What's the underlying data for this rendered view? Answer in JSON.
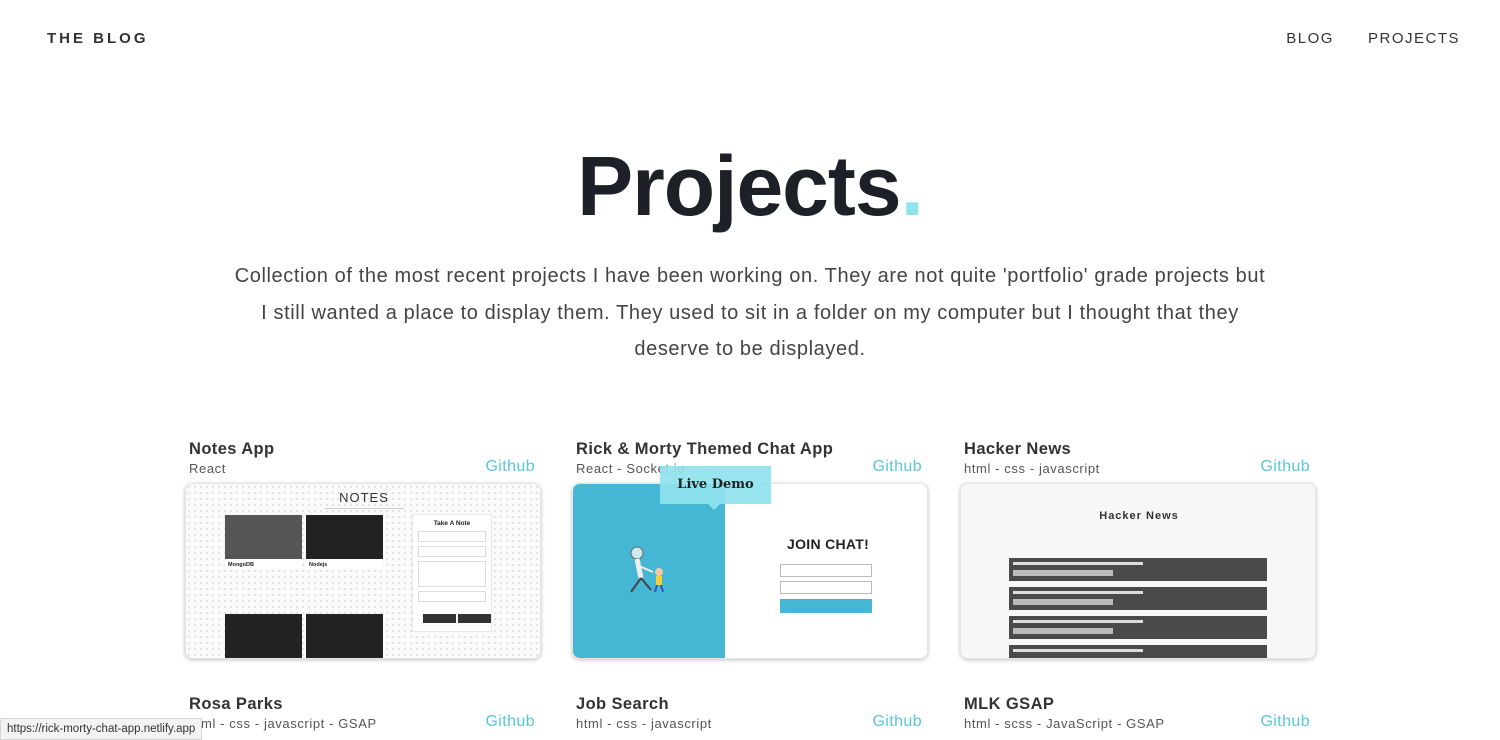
{
  "nav": {
    "brand": "THE BLOG",
    "links": [
      "BLOG",
      "PROJECTS"
    ]
  },
  "hero": {
    "title": "Projects",
    "dot": ".",
    "intro": "Collection of the most recent projects I have been working on. They are not quite 'portfolio' grade projects but I still wanted a place to display them. They used to sit in a folder on my computer but I thought that they deserve to be displayed."
  },
  "projects": [
    {
      "title": "Notes App",
      "tech": "React",
      "link": "Github",
      "thumb": {
        "heading": "NOTES",
        "form_title": "Take A Note",
        "notes": [
          "MongoDB",
          "Nodejs"
        ]
      }
    },
    {
      "title": "Rick & Morty Themed Chat App",
      "tech": "React - Socket.io",
      "link": "Github",
      "thumb": {
        "heading": "JOIN CHAT!"
      }
    },
    {
      "title": "Hacker News",
      "tech": "html - css - javascript",
      "link": "Github",
      "thumb": {
        "heading": "Hacker News"
      }
    },
    {
      "title": "Rosa Parks",
      "tech": "html - css - javascript - GSAP",
      "link": "Github"
    },
    {
      "title": "Job Search",
      "tech": "html - css - javascript",
      "link": "Github"
    },
    {
      "title": "MLK GSAP",
      "tech": "html - scss - JavaScript - GSAP",
      "link": "Github"
    }
  ],
  "tooltip": {
    "live_demo": "Live Demo"
  },
  "status_url": "https://rick-morty-chat-app.netlify.app",
  "colors": {
    "accent": "#56c8d8",
    "dot": "#8fe3ee",
    "chat_blue": "#45b7d4"
  }
}
